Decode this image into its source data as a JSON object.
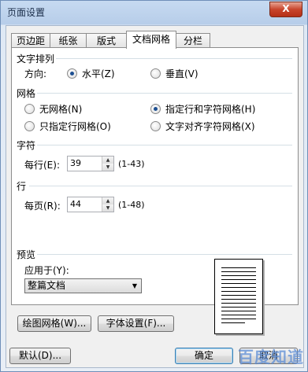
{
  "window": {
    "title": "页面设置",
    "close_symbol": "X"
  },
  "tabs": [
    {
      "label": "页边距",
      "active": false
    },
    {
      "label": "纸张",
      "active": false
    },
    {
      "label": "版式",
      "active": false
    },
    {
      "label": "文档网格",
      "active": true
    },
    {
      "label": "分栏",
      "active": false
    }
  ],
  "text_direction": {
    "section_label": "文字排列",
    "direction_label": "方向:",
    "options": [
      {
        "label": "水平(Z)",
        "checked": true
      },
      {
        "label": "垂直(V)",
        "checked": false
      }
    ]
  },
  "grid": {
    "section_label": "网格",
    "options": [
      {
        "label": "无网格(N)",
        "checked": false
      },
      {
        "label": "指定行和字符网格(H)",
        "checked": true
      },
      {
        "label": "只指定行网格(O)",
        "checked": false
      },
      {
        "label": "文字对齐字符网格(X)",
        "checked": false
      }
    ]
  },
  "characters": {
    "section_label": "字符",
    "per_line_label": "每行(E):",
    "per_line_value": "39",
    "per_line_range": "(1-43)"
  },
  "lines": {
    "section_label": "行",
    "per_page_label": "每页(R):",
    "per_page_value": "44",
    "per_page_range": "(1-48)"
  },
  "preview": {
    "section_label": "预览",
    "apply_to_label": "应用于(Y):",
    "apply_to_value": "整篇文档"
  },
  "buttons": {
    "draw_grid": "绘图网格(W)...",
    "font_settings": "字体设置(F)...",
    "default": "默认(D)...",
    "ok": "确定",
    "cancel": "取消"
  },
  "watermark": "百度知道"
}
